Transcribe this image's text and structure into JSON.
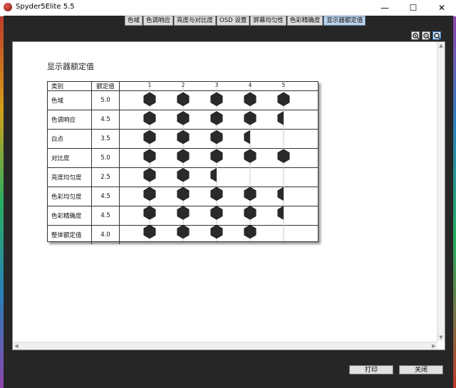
{
  "window": {
    "title": "Spyder5Elite 5.5",
    "minimize": "—",
    "maximize": "☐",
    "close": "✕"
  },
  "tabs": [
    {
      "label": "色域",
      "active": false
    },
    {
      "label": "色调响应",
      "active": false
    },
    {
      "label": "亮度与对比度",
      "active": false
    },
    {
      "label": "OSD 设置",
      "active": false
    },
    {
      "label": "屏幕均匀性",
      "active": false
    },
    {
      "label": "色彩精确度",
      "active": false
    },
    {
      "label": "显示器额定值",
      "active": true
    }
  ],
  "zoom_buttons": [
    "zoom-in-icon",
    "zoom-out-icon",
    "zoom-fit-icon"
  ],
  "report": {
    "title": "显示器额定值",
    "col_category": "类别",
    "col_rating": "额定值"
  },
  "chart_data": {
    "type": "table",
    "scale": [
      "1",
      "2",
      "3",
      "4",
      "5"
    ],
    "x_range": [
      1,
      5
    ],
    "rows": [
      {
        "category": "色域",
        "rating": "5.0",
        "value": 5.0
      },
      {
        "category": "色调响应",
        "rating": "4.5",
        "value": 4.5
      },
      {
        "category": "白点",
        "rating": "3.5",
        "value": 3.5
      },
      {
        "category": "对比度",
        "rating": "5.0",
        "value": 5.0
      },
      {
        "category": "亮度均匀度",
        "rating": "2.5",
        "value": 2.5
      },
      {
        "category": "色彩均匀度",
        "rating": "4.5",
        "value": 4.5
      },
      {
        "category": "色彩精确度",
        "rating": "4.5",
        "value": 4.5
      },
      {
        "category": "整体额定值",
        "rating": "4.0",
        "value": 4.0
      }
    ]
  },
  "buttons": {
    "print": "打印",
    "close": "关闭"
  },
  "colors": {
    "accent": "#bcd3ea",
    "marker": "#2a2a2a"
  }
}
